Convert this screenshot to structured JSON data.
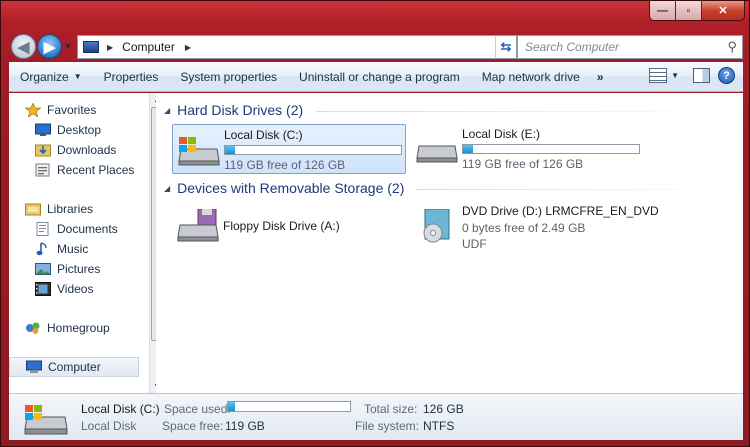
{
  "window": {
    "minimize": "—",
    "maximize": "▫",
    "close": "✕"
  },
  "nav": {
    "back_icon": "back-arrow-icon",
    "forward_icon": "forward-arrow-icon"
  },
  "address": {
    "separator": "▶",
    "location": "Computer"
  },
  "search": {
    "placeholder": "Search Computer"
  },
  "toolbar": {
    "organize": "Organize",
    "properties": "Properties",
    "system_properties": "System properties",
    "uninstall": "Uninstall or change a program",
    "map_drive": "Map network drive",
    "more": "»",
    "help": "?"
  },
  "sidebar": {
    "favorites": "Favorites",
    "desktop": "Desktop",
    "downloads": "Downloads",
    "recent": "Recent Places",
    "libraries": "Libraries",
    "documents": "Documents",
    "music": "Music",
    "pictures": "Pictures",
    "videos": "Videos",
    "homegroup": "Homegroup",
    "computer": "Computer"
  },
  "groups": {
    "hard_disks": "Hard Disk Drives (2)",
    "removable": "Devices with Removable Storage (2)"
  },
  "drives": {
    "c": {
      "name": "Local Disk (C:)",
      "free": "119 GB free of 126 GB",
      "used_fraction": 0.056
    },
    "e": {
      "name": "Local Disk (E:)",
      "free": "119 GB free of 126 GB",
      "used_fraction": 0.056
    },
    "a": {
      "name": "Floppy Disk Drive (A:)"
    },
    "d": {
      "name": "DVD Drive (D:) LRMCFRE_EN_DVD",
      "free": "0 bytes free of 2.49 GB",
      "fs": "UDF"
    }
  },
  "details": {
    "name": "Local Disk (C:)",
    "type": "Local Disk",
    "space_used_label": "Space used:",
    "space_free_label": "Space free:",
    "space_free": "119 GB",
    "total_size_label": "Total size:",
    "total_size": "126 GB",
    "fs_label": "File system:",
    "fs": "NTFS",
    "used_fraction": 0.056
  },
  "colors": {
    "frame": "#a11d25",
    "accent": "#1e3a78",
    "progress": "#1b8dd0"
  }
}
